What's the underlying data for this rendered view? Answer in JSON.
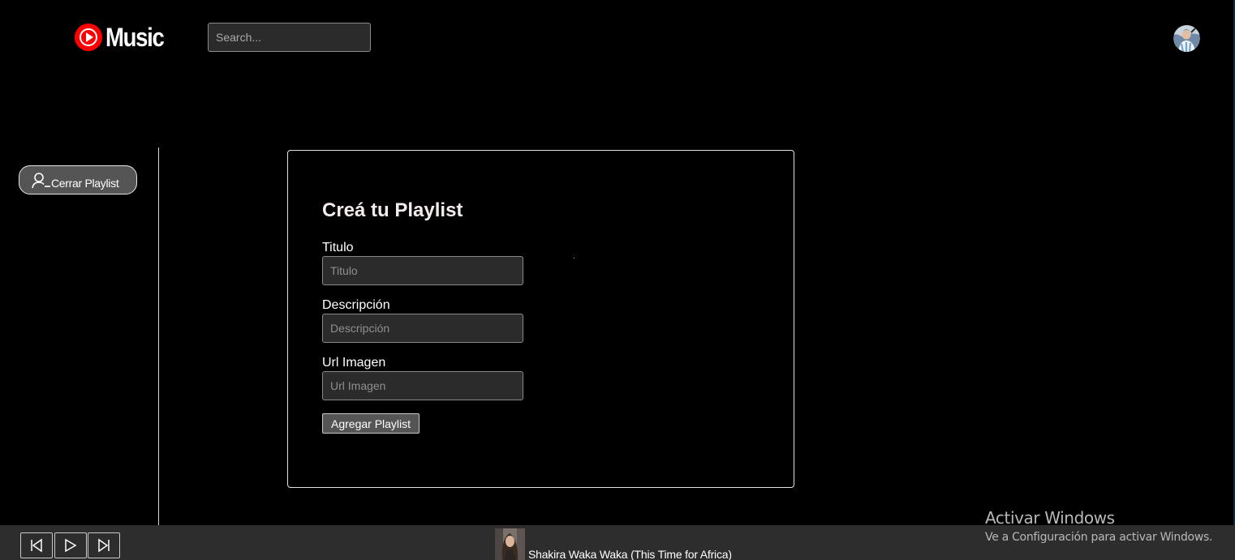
{
  "header": {
    "brand": "Music",
    "search_placeholder": "Search..."
  },
  "sidebar": {
    "close_playlist_label": "Cerrar Playlist"
  },
  "form": {
    "title": "Creá tu Playlist",
    "fields": [
      {
        "label": "Titulo",
        "placeholder": "Titulo",
        "value": ""
      },
      {
        "label": "Descripción",
        "placeholder": "Descripción",
        "value": ""
      },
      {
        "label": "Url Imagen",
        "placeholder": "Url Imagen",
        "value": ""
      }
    ],
    "submit_label": "Agregar Playlist"
  },
  "player": {
    "controls": [
      "previous-icon",
      "play-icon",
      "next-icon"
    ],
    "now_playing": "Shakira Waka Waka (This Time for Africa)"
  },
  "watermark": {
    "title": "Activar Windows",
    "subtitle": "Ve a Configuración para activar Windows."
  },
  "colors": {
    "background": "#000000",
    "brand_red": "#ff0000",
    "player_bar": "#2d2d2d",
    "input_bg": "#2b2b2b"
  }
}
